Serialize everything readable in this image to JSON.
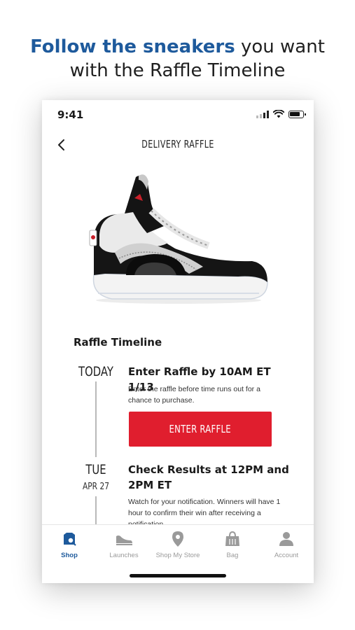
{
  "promo": {
    "headline_accent": "Follow the sneakers",
    "headline_rest_line1": " you want",
    "headline_line2": "with the Raffle Timeline"
  },
  "status_bar": {
    "time": "9:41"
  },
  "header": {
    "title": "DELIVERY RAFFLE",
    "back_icon": "chevron-left-icon"
  },
  "product": {
    "image_icon": "sneaker-image"
  },
  "timeline": {
    "title": "Raffle Timeline",
    "steps": [
      {
        "date_main": "TODAY",
        "date_sub": "",
        "heading": "Enter Raffle by 10AM ET 1/13",
        "description": "Enter the raffle before time runs out for a chance to purchase."
      },
      {
        "date_main": "TUE",
        "date_sub": "APR 27",
        "heading": "Check Results at 12PM and 2PM ET",
        "description": "Watch for your notification. Winners will have 1 hour to confirm their win after receiving a notification."
      }
    ],
    "enter_button_label": "ENTER RAFFLE",
    "enter_button_color": "#e01e2e"
  },
  "tabbar": {
    "active_color": "#1e5a9c",
    "items": [
      {
        "label": "Shop",
        "icon": "shop-icon",
        "active": true
      },
      {
        "label": "Launches",
        "icon": "sneaker-icon",
        "active": false
      },
      {
        "label": "Shop My Store",
        "icon": "location-pin-icon",
        "active": false
      },
      {
        "label": "Bag",
        "icon": "bag-icon",
        "active": false
      },
      {
        "label": "Account",
        "icon": "person-icon",
        "active": false
      }
    ]
  }
}
